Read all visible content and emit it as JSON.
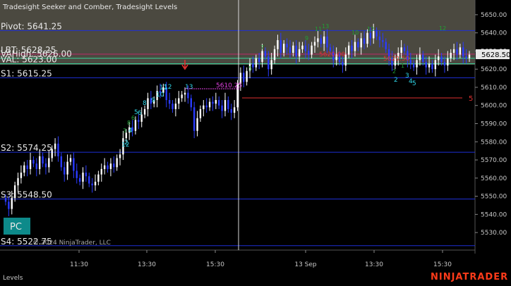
{
  "title": "Tradesight Seeker and Comber, Tradesight Levels",
  "footer": {
    "tab_label": "Levels",
    "brand": "NINJATRADER",
    "copyright": "© 2024 NinjaTrader, LLC",
    "pc_label": "PC"
  },
  "colors": {
    "background": "#000000",
    "overnight_shade": "#4b4940",
    "level_line": "#1e2fd6",
    "lbt_line": "#c02a6a",
    "val_line": "#37d49a",
    "bull_candle": "#ffffff",
    "bear_candle": "#2a3bff",
    "seeker_cyan": "#2fd5e6",
    "comber_green": "#1fa035",
    "red_marker": "#e03030",
    "magenta": "#e040e0",
    "price_badge": "#e8e8e8",
    "brand_red": "#ff3b1a"
  },
  "levels": [
    {
      "label": "Pivot: 5641.25",
      "value": 5641.25
    },
    {
      "label": "LBT: 5628.25",
      "value": 5628.25
    },
    {
      "label": "VAHigh: 5626.00",
      "value": 5626.0
    },
    {
      "label": "VAL: 5623.00",
      "value": 5623.0
    },
    {
      "label": "S1: 5615.25",
      "value": 5615.25
    },
    {
      "label": "S2: 5574.25",
      "value": 5574.25
    },
    {
      "label": "S3: 5548.50",
      "value": 5548.5
    },
    {
      "label": "S4: 5522.75",
      "value": 5522.75
    }
  ],
  "annotations": {
    "overnight_high": "5610.25",
    "left_label_1": "5620.00",
    "right_label_1": "5620.50",
    "right_red_number": "5"
  },
  "current_price": "5628.50",
  "y_axis": {
    "min": 5525,
    "max": 5655,
    "ticks": [
      5530,
      5540,
      5550,
      5560,
      5570,
      5580,
      5590,
      5600,
      5610,
      5620,
      5630,
      5640,
      5650
    ]
  },
  "x_axis": {
    "ticks": [
      "11:30",
      "13:30",
      "15:30",
      "13 Sep",
      "13:30",
      "15:30"
    ]
  },
  "chart_data": {
    "type": "candlestick",
    "title": "Tradesight Seeker and Comber, Tradesight Levels",
    "y_range": [
      5525,
      5655
    ],
    "x_ticks": [
      "11:30",
      "13:30",
      "15:30",
      "13 Sep",
      "13:30",
      "15:30"
    ],
    "close": [
      5547,
      5543,
      5549,
      5556,
      5560,
      5563,
      5567,
      5565,
      5570,
      5568,
      5565,
      5572,
      5568,
      5566,
      5571,
      5576,
      5579,
      5572,
      5566,
      5562,
      5569,
      5571,
      5564,
      5560,
      5558,
      5563,
      5561,
      5557,
      5556,
      5558,
      5562,
      5565,
      5567,
      5565,
      5568,
      5566,
      5571,
      5573,
      5582,
      5585,
      5588,
      5586,
      5592,
      5591,
      5595,
      5598,
      5604,
      5601,
      5603,
      5608,
      5607,
      5610,
      5603,
      5601,
      5598,
      5601,
      5604,
      5606,
      5607,
      5604,
      5599,
      5586,
      5593,
      5598,
      5600,
      5599,
      5602,
      5601,
      5603,
      5600,
      5597,
      5603,
      5598,
      5596,
      5599,
      5612,
      5618,
      5613,
      5619,
      5623,
      5621,
      5626,
      5624,
      5630,
      5627,
      5620,
      5625,
      5631,
      5636,
      5629,
      5634,
      5632,
      5629,
      5633,
      5627,
      5631,
      5633,
      5630,
      5628,
      5633,
      5635,
      5637,
      5634,
      5638,
      5632,
      5630,
      5625,
      5628,
      5624,
      5622,
      5628,
      5633,
      5630,
      5635,
      5632,
      5637,
      5634,
      5640,
      5637,
      5641,
      5638,
      5636,
      5635,
      5631,
      5626,
      5622,
      5626,
      5629,
      5632,
      5630,
      5625,
      5623,
      5621,
      5625,
      5628,
      5624,
      5621,
      5623,
      5620,
      5625,
      5627,
      5624,
      5622,
      5626,
      5629,
      5631,
      5628,
      5632,
      5627,
      5626,
      5628
    ]
  }
}
